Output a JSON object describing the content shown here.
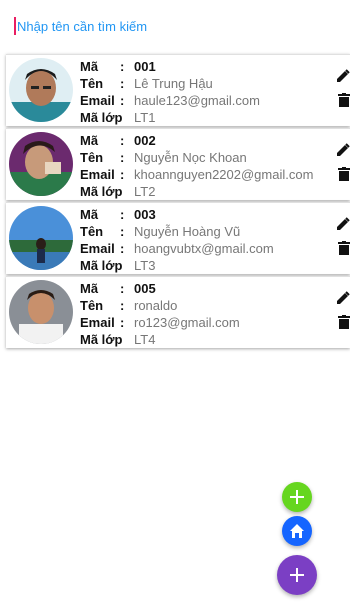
{
  "search": {
    "placeholder": "Nhập tên cần tìm kiếm"
  },
  "labels": {
    "id": "Mã",
    "name": "Tên",
    "email": "Email",
    "class": "Mã lớp",
    "colon": ":"
  },
  "students": [
    {
      "id": "001",
      "name": "Lê Trung Hậu",
      "email": "haule123@gmail.com",
      "class": "LT1",
      "avatar": "avatar-photo-1"
    },
    {
      "id": "002",
      "name": "Nguyễn Nọc Khoan",
      "email": "khoannguyen2202@gmail.com",
      "class": "LT2",
      "avatar": "avatar-photo-2"
    },
    {
      "id": "003",
      "name": "Nguyễn Hoàng Vũ",
      "email": "hoangvubtx@gmail.com",
      "class": "LT3",
      "avatar": "avatar-photo-3"
    },
    {
      "id": "005",
      "name": "ronaldo",
      "email": "ro123@gmail.com",
      "class": "LT4",
      "avatar": "avatar-photo-4"
    }
  ],
  "icons": {
    "edit": "pencil-icon",
    "delete": "trash-icon",
    "add": "plus-icon",
    "home": "home-icon"
  },
  "colors": {
    "accent": "#2196f3",
    "fab_green": "#66d61f",
    "fab_blue": "#1565ff",
    "fab_purple": "#7b3fc4"
  }
}
